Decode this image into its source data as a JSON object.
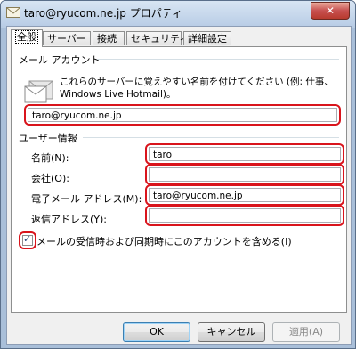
{
  "window": {
    "title": "taro@ryucom.ne.jp プロパティ",
    "close_label": "✕"
  },
  "tabs": [
    {
      "label": "全般",
      "active": true
    },
    {
      "label": "サーバー",
      "active": false
    },
    {
      "label": "接続",
      "active": false
    },
    {
      "label": "セキュリティ",
      "active": false
    },
    {
      "label": "詳細設定",
      "active": false
    }
  ],
  "mail_account": {
    "heading": "メール アカウント",
    "description": "これらのサーバーに覚えやすい名前を付けてください (例: 仕事、Windows Live Hotmail)。",
    "account_name": "taro@ryucom.ne.jp"
  },
  "user_info": {
    "heading": "ユーザー情報",
    "name_label": "名前(N):",
    "name_value": "taro",
    "company_label": "会社(O):",
    "company_value": "",
    "email_label": "電子メール アドレス(M):",
    "email_value": "taro@ryucom.ne.jp",
    "reply_label": "返信アドレス(Y):",
    "reply_value": ""
  },
  "include_account": {
    "label": "メールの受信時および同期時にこのアカウントを含める(I)",
    "checked": true,
    "mark": "✓"
  },
  "buttons": {
    "ok": "OK",
    "cancel": "キャンセル",
    "apply": "適用(A)"
  },
  "colors": {
    "highlight": "#d9141c",
    "titlebar": "#c5d6ea"
  }
}
